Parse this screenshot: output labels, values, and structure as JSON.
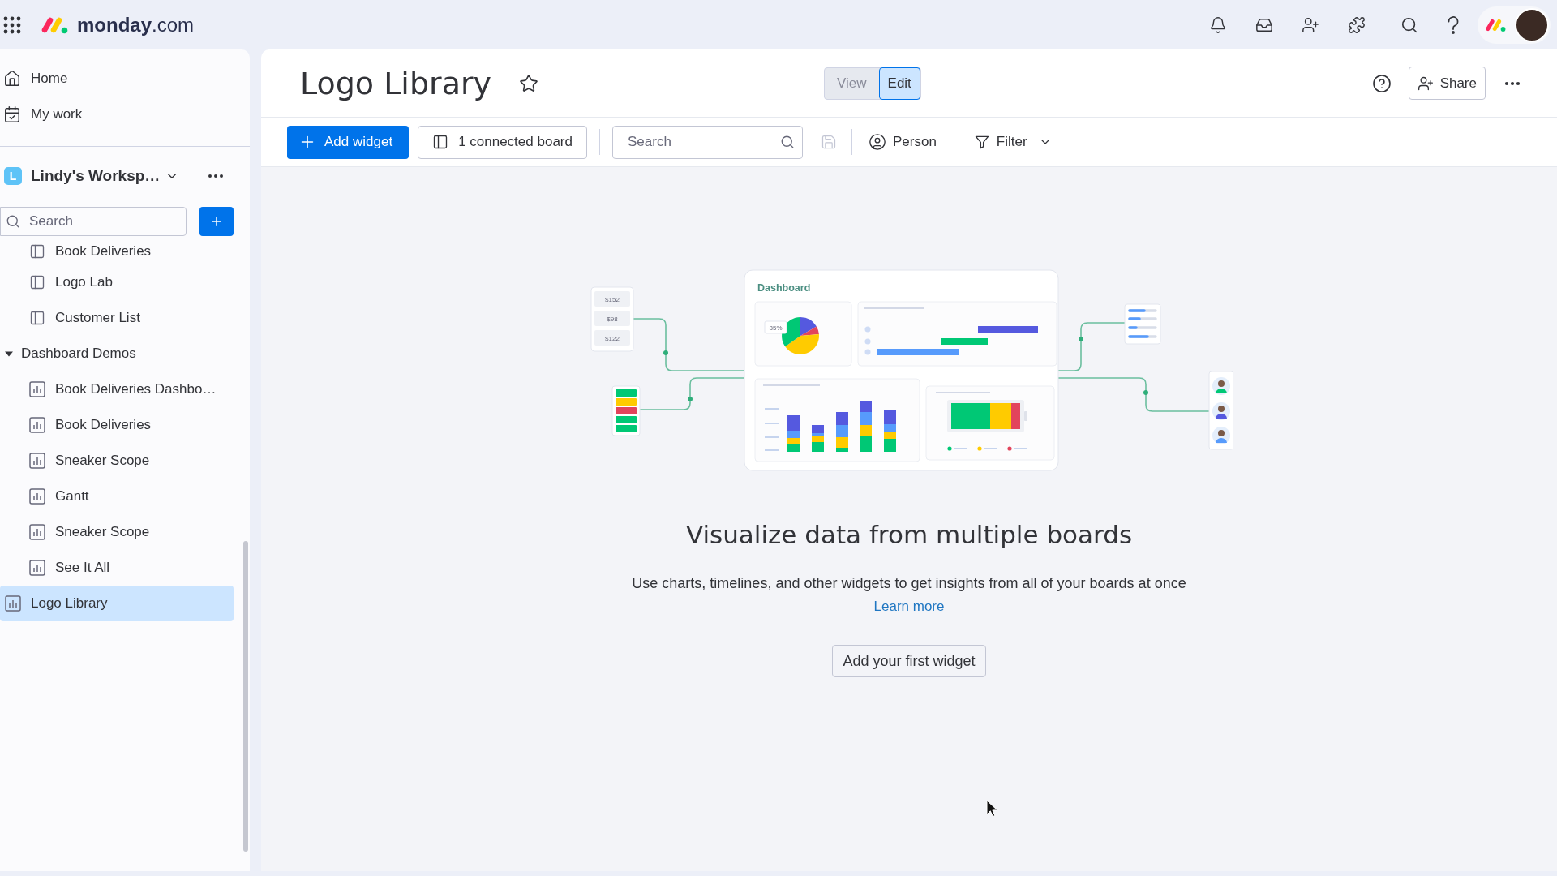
{
  "top_bar": {
    "logo": "**monday**.com"
  },
  "sidebar": {
    "nav": [
      {
        "kind": "home",
        "label": "Home"
      },
      {
        "kind": "work",
        "label": "My work"
      }
    ],
    "workspace": {
      "initial": "L",
      "name": "Lindy's Worksp…"
    },
    "search": {
      "placeholder": "Search"
    },
    "continued_items": [
      {
        "kind": "board",
        "label": "Book Deliveries",
        "selected": false
      },
      {
        "kind": "board",
        "label": "Logo Lab",
        "selected": false
      },
      {
        "kind": "board",
        "label": "Customer List",
        "selected": false
      }
    ],
    "items": [
      {
        "kind": "folder",
        "label": "Dashboard Demos",
        "expanded": true,
        "children": [
          {
            "kind": "dashboard",
            "label": "Book Deliveries Dashbo…",
            "selected": false
          },
          {
            "kind": "dashboard",
            "label": "Book Deliveries",
            "selected": false
          },
          {
            "kind": "dashboard",
            "label": "Sneaker Scope",
            "selected": false
          },
          {
            "kind": "dashboard",
            "label": "Gantt",
            "selected": false
          },
          {
            "kind": "dashboard",
            "label": "Sneaker Scope",
            "selected": false
          },
          {
            "kind": "dashboard",
            "label": "See It All",
            "selected": false
          }
        ]
      },
      {
        "kind": "dashboard",
        "label": "Logo Library",
        "selected": true
      }
    ]
  },
  "board_header": {
    "title": "Logo Library",
    "mode_toggle": [
      {
        "label": "View",
        "selected": false
      },
      {
        "label": "Edit",
        "selected": true
      }
    ],
    "share_button": "Share"
  },
  "toolbar": {
    "add_widget": "Add widget",
    "connected_boards": "1 connected board",
    "search": {
      "placeholder": "Search"
    },
    "save": {
      "disabled": true
    },
    "person_filter": "Person",
    "filter": "Filter"
  },
  "illustration": {
    "price_tags": [
      "$152",
      "$98",
      "$122"
    ],
    "card_title": "Dashboard",
    "pie_label": "35%"
  },
  "empty_state": {
    "heading": "Visualize data from multiple boards",
    "text": "Use charts, timelines, and other widgets to get insights from all of your boards at once",
    "link": "Learn more",
    "button": "Add your first widget"
  }
}
